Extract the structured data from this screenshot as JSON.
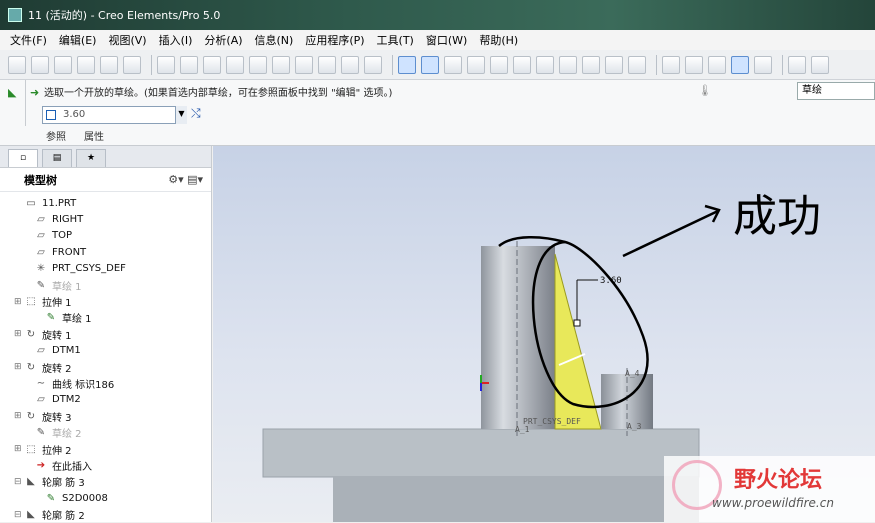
{
  "window": {
    "title": "11 (活动的) - Creo Elements/Pro 5.0"
  },
  "menu": [
    "文件(F)",
    "编辑(E)",
    "视图(V)",
    "插入(I)",
    "分析(A)",
    "信息(N)",
    "应用程序(P)",
    "工具(T)",
    "窗口(W)",
    "帮助(H)"
  ],
  "dashboard": {
    "message": "选取一个开放的草绘。(如果首选内部草绘，可在参照面板中找到 \"编辑\" 选项。)",
    "dimension_value": "3.60",
    "tabs": [
      "参照",
      "属性"
    ],
    "filter_value": "草绘"
  },
  "navigator": {
    "header": "模型树",
    "items": [
      {
        "label": "11.PRT",
        "icon": "part-icon",
        "indent": 0,
        "dim": false,
        "expand": ""
      },
      {
        "label": "RIGHT",
        "icon": "datum-plane-icon",
        "indent": 1,
        "dim": false,
        "expand": ""
      },
      {
        "label": "TOP",
        "icon": "datum-plane-icon",
        "indent": 1,
        "dim": false,
        "expand": ""
      },
      {
        "label": "FRONT",
        "icon": "datum-plane-icon",
        "indent": 1,
        "dim": false,
        "expand": ""
      },
      {
        "label": "PRT_CSYS_DEF",
        "icon": "csys-icon",
        "indent": 1,
        "dim": false,
        "expand": ""
      },
      {
        "label": "草绘 1",
        "icon": "sketch-icon",
        "indent": 1,
        "dim": true,
        "expand": ""
      },
      {
        "label": "拉伸 1",
        "icon": "extrude-icon",
        "indent": 0,
        "dim": false,
        "expand": "+"
      },
      {
        "label": "草绘 1",
        "icon": "sketch-icon",
        "indent": 2,
        "dim": false,
        "expand": ""
      },
      {
        "label": "旋转 1",
        "icon": "revolve-icon",
        "indent": 0,
        "dim": false,
        "expand": "+"
      },
      {
        "label": "DTM1",
        "icon": "datum-plane-icon",
        "indent": 1,
        "dim": false,
        "expand": ""
      },
      {
        "label": "旋转 2",
        "icon": "revolve-icon",
        "indent": 0,
        "dim": false,
        "expand": "+"
      },
      {
        "label": "曲线 标识186",
        "icon": "curve-icon",
        "indent": 1,
        "dim": false,
        "expand": ""
      },
      {
        "label": "DTM2",
        "icon": "datum-plane-icon",
        "indent": 1,
        "dim": false,
        "expand": ""
      },
      {
        "label": "旋转 3",
        "icon": "revolve-icon",
        "indent": 0,
        "dim": false,
        "expand": "+"
      },
      {
        "label": "草绘 2",
        "icon": "sketch-icon",
        "indent": 1,
        "dim": true,
        "expand": ""
      },
      {
        "label": "拉伸 2",
        "icon": "extrude-icon",
        "indent": 0,
        "dim": false,
        "expand": "+"
      },
      {
        "label": "在此插入",
        "icon": "insert-arrow-icon",
        "indent": 1,
        "dim": false,
        "expand": ""
      },
      {
        "label": "轮廓 筋 3",
        "icon": "rib-icon",
        "indent": 0,
        "dim": false,
        "expand": "-"
      },
      {
        "label": "S2D0008",
        "icon": "sketch-icon",
        "indent": 2,
        "dim": false,
        "expand": ""
      },
      {
        "label": "轮廓 筋 2",
        "icon": "rib-icon",
        "indent": 0,
        "dim": false,
        "expand": "-"
      }
    ]
  },
  "viewport": {
    "dimension_label": "3.60",
    "csys_label": "PRT_CSYS_DEF",
    "axis_label_a4": "A_4",
    "axis_label_a3": "A_3",
    "axis_label_a1": "A_1",
    "annotation": "成功"
  },
  "watermark": {
    "title": "野火论坛",
    "url": "www.proewildfire.cn"
  },
  "colors": {
    "rib_fill": "#e8e85a",
    "annotation_ink": "#000000"
  }
}
